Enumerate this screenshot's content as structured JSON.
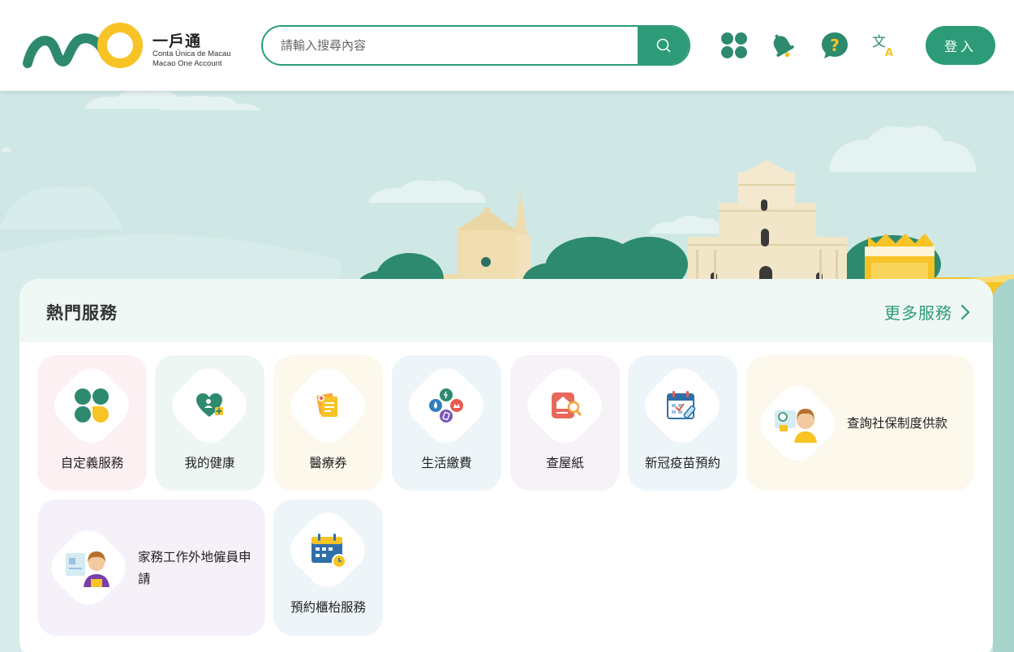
{
  "header": {
    "logo_title": "一戶通",
    "logo_sub_pt": "Conta Única de Macau",
    "logo_sub_en": "Macao One Account",
    "search_placeholder": "請輸入搜尋內容",
    "login_label": "登入"
  },
  "icons": {
    "search": "search-icon",
    "clover": "clover-icon",
    "notification": "bell-icon",
    "help": "question-icon",
    "language": "translate-icon"
  },
  "colors": {
    "brand_green": "#2d9b78",
    "brand_yellow": "#f7c325",
    "banner_sky": "#cfe8e6"
  },
  "hot_services": {
    "title": "熱門服務",
    "more_label": "更多服務",
    "items": [
      {
        "label": "自定義服務",
        "icon": "clover-icon"
      },
      {
        "label": "我的健康",
        "icon": "heart-health-icon"
      },
      {
        "label": "醫療券",
        "icon": "medical-voucher-icon"
      },
      {
        "label": "生活繳費",
        "icon": "utility-bill-icon"
      },
      {
        "label": "查屋紙",
        "icon": "property-search-icon"
      },
      {
        "label": "新冠疫苗預約",
        "icon": "vaccine-calendar-icon"
      },
      {
        "label": "查詢社保制度供款",
        "icon": "social-security-icon"
      },
      {
        "label": "家務工作外地僱員申請",
        "icon": "domestic-worker-icon"
      },
      {
        "label": "預約櫃枱服務",
        "icon": "counter-booking-icon"
      }
    ]
  }
}
